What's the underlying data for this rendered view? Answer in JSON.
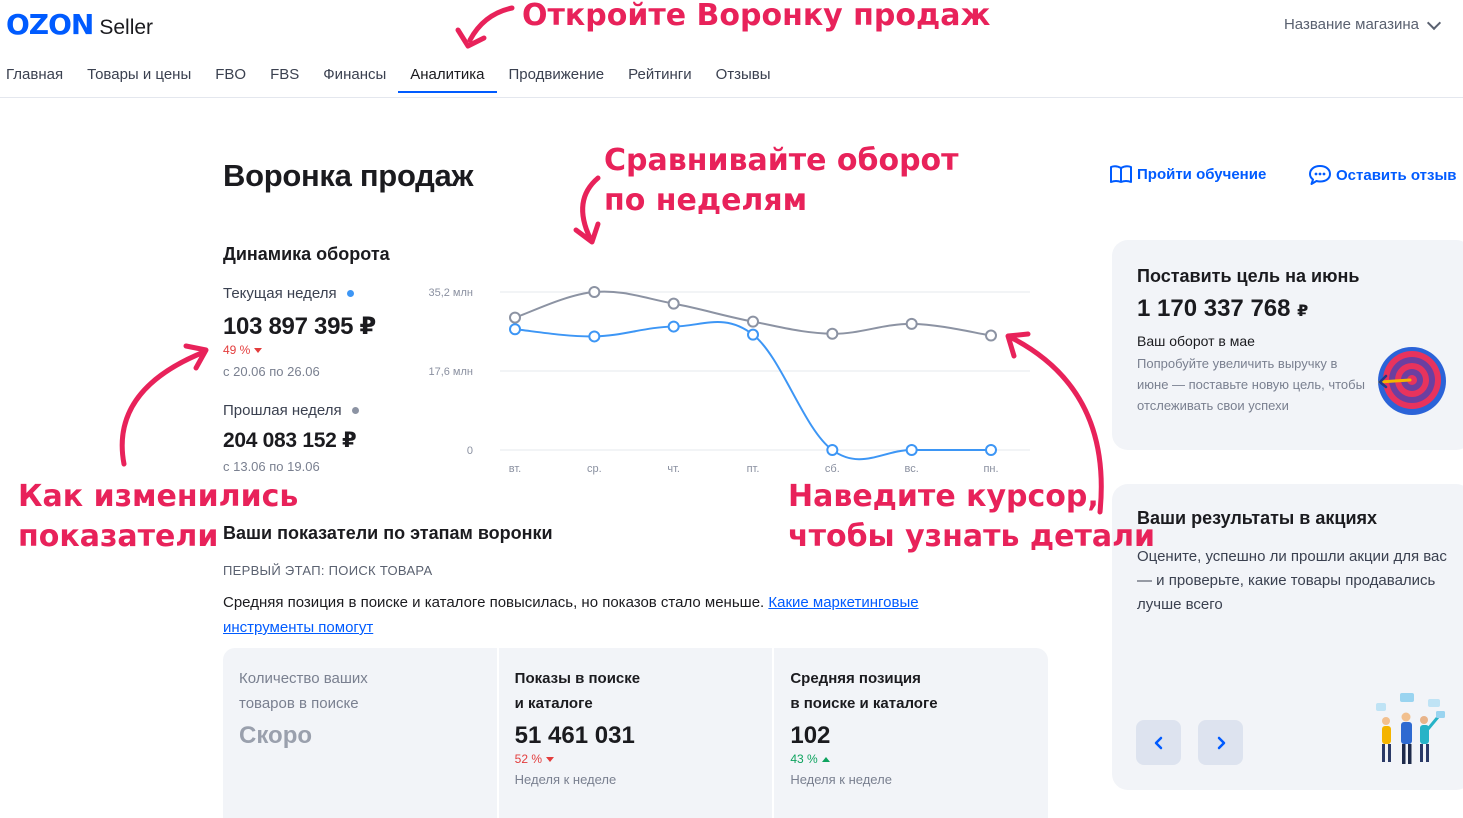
{
  "header": {
    "logo_brand": "OZON",
    "logo_product": "Seller",
    "shop_name": "Название магазина",
    "nav": [
      "Главная",
      "Товары и цены",
      "FBO",
      "FBS",
      "Финансы",
      "Аналитика",
      "Продвижение",
      "Рейтинги",
      "Отзывы"
    ],
    "active_nav": "Аналитика"
  },
  "page": {
    "title": "Воронка продаж",
    "link_training": "Пройти обучение",
    "link_feedback": "Оставить отзыв"
  },
  "dynamics": {
    "title": "Динамика оборота",
    "current": {
      "label": "Текущая неделя",
      "value": "103 897 395 ₽",
      "change": "49 %",
      "period": "с 20.06 по 26.06",
      "dot_color": "#3d96f5"
    },
    "previous": {
      "label": "Прошлая неделя",
      "value": "204 083 152 ₽",
      "period": "с 13.06 по 19.06",
      "dot_color": "#8c93a3"
    }
  },
  "chart_data": {
    "type": "line",
    "categories": [
      "вт.",
      "ср.",
      "чт.",
      "пт.",
      "сб.",
      "вс.",
      "пн."
    ],
    "y_tick_labels": [
      "35,2 млн",
      "17,6 млн",
      "0"
    ],
    "ylim": [
      0,
      35.2
    ],
    "grid": true,
    "series": [
      {
        "color": "#8c93a3",
        "values": [
          29.5,
          35.2,
          32.6,
          28.6,
          25.9,
          28.1,
          25.5
        ]
      },
      {
        "color": "#3d96f5",
        "values": [
          26.9,
          25.3,
          27.5,
          25.7,
          0,
          0,
          0
        ]
      }
    ]
  },
  "funnel": {
    "title": "Ваши показатели по этапам воронки",
    "stage": "ПЕРВЫЙ ЭТАП: ПОИСК ТОВАРА",
    "description": "Средняя позиция в поиске и каталоге повысилась, но показов стало меньше. ",
    "link": "Какие маркетинговые инструменты помогут",
    "cards": [
      {
        "title": "Количество ваших\nтоваров в поиске",
        "value": "Скоро"
      },
      {
        "title": "Показы в поиске\nи каталоге",
        "value": "51 461 031",
        "change": "52 %",
        "sub": "Неделя к неделе"
      },
      {
        "title": "Средняя позиция\nв поиске и каталоге",
        "value": "102",
        "change": "43 %",
        "sub": "Неделя к неделе"
      }
    ]
  },
  "goal_panel": {
    "title": "Поставить цель на июнь",
    "amount": "1 170 337 768",
    "currency": "₽",
    "subtitle": "Ваш оборот в мае",
    "note": "Попробуйте увеличить выручку в июне — поставьте новую цель, чтобы отслеживать свои успехи"
  },
  "promo_panel": {
    "title": "Ваши результаты в акциях",
    "text": "Оцените, успешно ли прошли акции для вас — и проверьте, какие товары продавались лучше всего"
  },
  "annotations": {
    "a1": "Откройте Воронку продаж",
    "a2_line1": "Сравнивайте оборот",
    "a2_line2": "по неделям",
    "a3_line1": "Как изменились",
    "a3_line2": "показатели",
    "a4_line1": "Наведите курсор,",
    "a4_line2": "чтобы узнать детали",
    "color": "#e8225a"
  }
}
